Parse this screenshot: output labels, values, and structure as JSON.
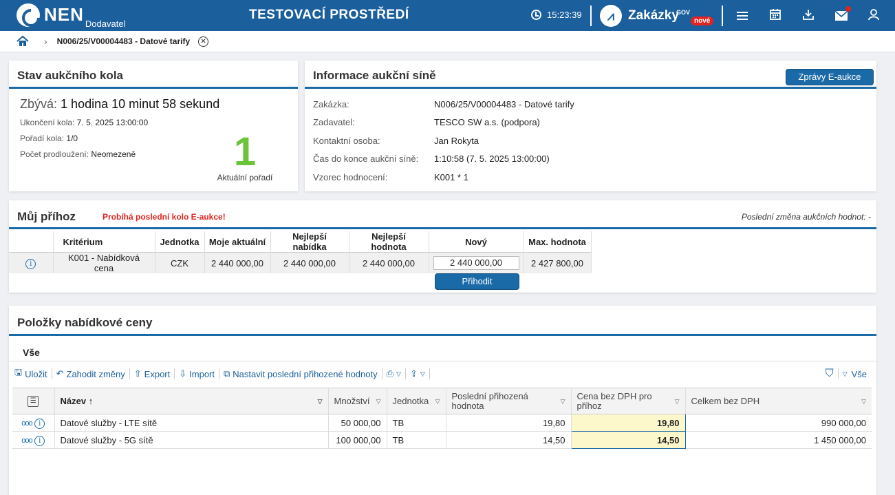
{
  "header": {
    "logo_text": "NEN",
    "logo_sub": "Dodavatel",
    "env_title": "TESTOVACÍ PROSTŘEDÍ",
    "time": "15:23:39",
    "zak_text": "Zakázky",
    "zak_gov": "GOV",
    "zak_badge": "nové"
  },
  "breadcrumb": {
    "path": "N006/25/V00004483 - Datové tarify"
  },
  "round": {
    "title": "Stav aukčního kola",
    "remaining_label": "Zbývá:",
    "remaining_value": "1 hodina 10 minut 58 sekund",
    "end_label": "Ukončení kola:",
    "end_value": "7. 5. 2025 13:00:00",
    "order_label": "Pořadí kola:",
    "order_value": "1/0",
    "ext_label": "Počet prodloužení:",
    "ext_value": "Neomezeně",
    "rank_value": "1",
    "rank_label": "Aktuální pořadí"
  },
  "info": {
    "title": "Informace aukční síně",
    "messages_button": "Zprávy E-aukce",
    "rows": [
      {
        "k": "Zakázka:",
        "v": "N006/25/V00004483 - Datové tarify"
      },
      {
        "k": "Zadavatel:",
        "v": "TESCO SW a.s. (podpora)"
      },
      {
        "k": "Kontaktní osoba:",
        "v": "Jan Rokyta"
      },
      {
        "k": "Čas do konce aukční síně:",
        "v": "1:10:58 (7. 5. 2025 13:00:00)"
      },
      {
        "k": "Vzorec hodnocení:",
        "v": "K001 * 1"
      }
    ]
  },
  "bid": {
    "title": "Můj příhoz",
    "alert": "Probíhá poslední kolo E-aukce!",
    "last_change": "Poslední změna aukčních hodnot: -",
    "columns": [
      "Kritérium",
      "Jednotka",
      "Moje aktuální",
      "Nejlepší nabídka",
      "Nejlepší hodnota",
      "Nový",
      "Max. hodnota"
    ],
    "row": {
      "criterion": "K001 - Nabídková cena",
      "unit": "CZK",
      "mine": "2 440 000,00",
      "best_offer": "2 440 000,00",
      "best_value": "2 440 000,00",
      "new": "2 440 000,00",
      "max": "2 427 800,00"
    },
    "submit_button": "Přihodit"
  },
  "items": {
    "title": "Položky nabídkové ceny",
    "tab": "Vše",
    "toolbar": {
      "save": "Uložit",
      "discard": "Zahodit změny",
      "export": "Export",
      "import": "Import",
      "set_last": "Nastavit poslední přihozené hodnoty",
      "filter_all": "Vše"
    },
    "columns": {
      "name": "Název",
      "qty": "Množství",
      "unit": "Jednotka",
      "last_bid_1": "Poslední přihozená",
      "last_bid_2": "hodnota",
      "price_1": "Cena bez DPH pro",
      "price_2": "příhoz",
      "total": "Celkem bez DPH"
    },
    "rows": [
      {
        "name": "Datové služby - LTE sítě",
        "qty": "50 000,00",
        "unit": "TB",
        "last": "19,80",
        "price": "19,80",
        "total": "990 000,00"
      },
      {
        "name": "Datové služby - 5G sítě",
        "qty": "100 000,00",
        "unit": "TB",
        "last": "14,50",
        "price": "14,50",
        "total": "1 450 000,00"
      }
    ]
  }
}
